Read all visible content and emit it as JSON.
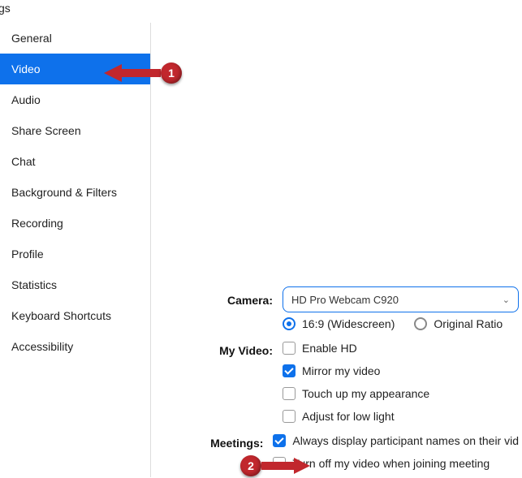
{
  "window": {
    "title_fragment": "gs"
  },
  "sidebar": {
    "items": [
      {
        "label": "General",
        "active": false
      },
      {
        "label": "Video",
        "active": true
      },
      {
        "label": "Audio",
        "active": false
      },
      {
        "label": "Share Screen",
        "active": false
      },
      {
        "label": "Chat",
        "active": false
      },
      {
        "label": "Background & Filters",
        "active": false
      },
      {
        "label": "Recording",
        "active": false
      },
      {
        "label": "Profile",
        "active": false
      },
      {
        "label": "Statistics",
        "active": false
      },
      {
        "label": "Keyboard Shortcuts",
        "active": false
      },
      {
        "label": "Accessibility",
        "active": false
      }
    ]
  },
  "settings": {
    "camera": {
      "label": "Camera:",
      "selected": "HD Pro Webcam C920",
      "aspect": {
        "options": [
          {
            "label": "16:9 (Widescreen)",
            "checked": true
          },
          {
            "label": "Original Ratio",
            "checked": false
          }
        ]
      }
    },
    "my_video": {
      "label": "My Video:",
      "options": [
        {
          "label": "Enable HD",
          "checked": false
        },
        {
          "label": "Mirror my video",
          "checked": true
        },
        {
          "label": "Touch up my appearance",
          "checked": false
        },
        {
          "label": "Adjust for low light",
          "checked": false
        }
      ]
    },
    "meetings": {
      "label": "Meetings:",
      "options": [
        {
          "label": "Always display participant names on their vid",
          "checked": true
        },
        {
          "label": "Turn off my video when joining meeting",
          "checked": false
        }
      ]
    }
  },
  "annotations": {
    "one": "1",
    "two": "2"
  },
  "colors": {
    "accent": "#0e71eb",
    "callout": "#c1272d"
  }
}
